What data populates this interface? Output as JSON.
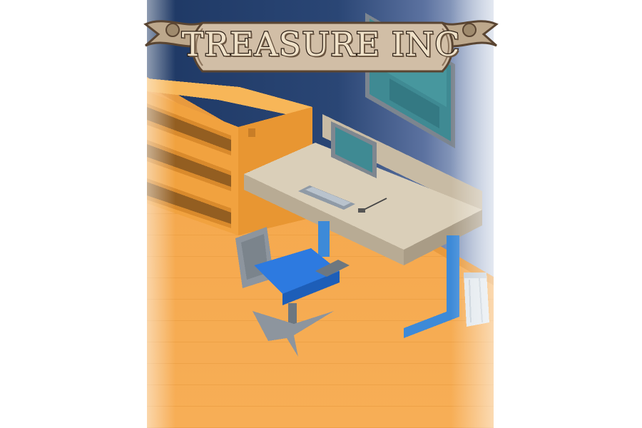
{
  "game": {
    "title": "TREASURE INC"
  },
  "colors": {
    "wall": "#23406e",
    "wall_edge": "#7f93b8",
    "floor": "#f5a84c",
    "desk_top": "#d8ccb7",
    "desk_legs": "#3d8ad8",
    "chair": "#2d7ae0",
    "cabinet": "#f0a23b",
    "screen": "#3f8a93",
    "banner": "#ccb69b"
  },
  "icons": [
    "scroll-banner",
    "wall-monitor",
    "desk-computer",
    "office-chair",
    "filing-cabinet",
    "trash-bin"
  ]
}
